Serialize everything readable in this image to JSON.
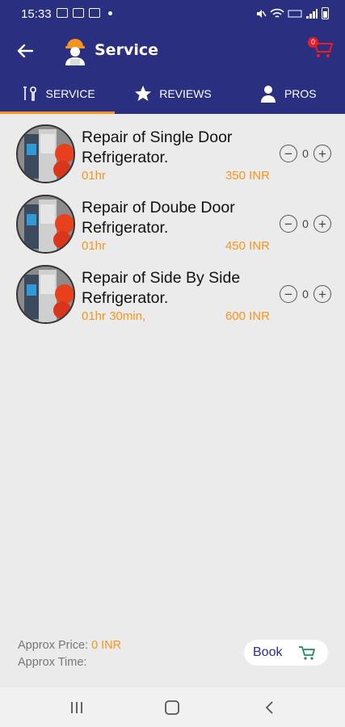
{
  "status_bar": {
    "time": "15:33",
    "left_icons": [
      "image-icon",
      "mail-icon",
      "mail-icon",
      "dot-icon"
    ],
    "right_icons": [
      "mute-icon",
      "wifi-icon",
      "volte-icon",
      "signal-icon",
      "battery-icon"
    ]
  },
  "app_bar": {
    "title": "Service",
    "cart_count": "0"
  },
  "tabs": [
    {
      "label": "SERVICE",
      "icon": "tools-icon",
      "active": true
    },
    {
      "label": "REVIEWS",
      "icon": "star-icon",
      "active": false
    },
    {
      "label": "PROS",
      "icon": "person-icon",
      "active": false
    }
  ],
  "services": [
    {
      "title": "Repair of Single Door Refrigerator.",
      "duration": "01hr",
      "price": "350 INR",
      "quantity": "0"
    },
    {
      "title": "Repair of Doube Door Refrigerator.",
      "duration": "01hr",
      "price": "450 INR",
      "quantity": "0"
    },
    {
      "title": "Repair of Side By Side Refrigerator.",
      "duration": "01hr 30min,",
      "price": "600 INR",
      "quantity": "0"
    }
  ],
  "summary": {
    "price_label": "Approx Price:",
    "price_value": " 0 INR",
    "time_label": "Approx Time:",
    "time_value": ""
  },
  "book_button": {
    "label": "Book"
  },
  "colors": {
    "primary": "#2a2f7f",
    "accent": "#f7941d",
    "badge": "#ec1c24",
    "background": "#ebebeb"
  }
}
